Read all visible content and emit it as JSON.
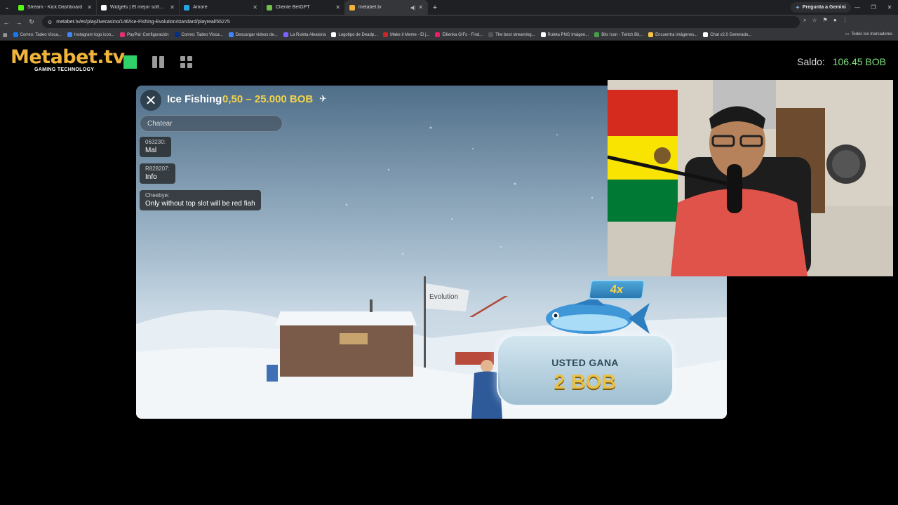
{
  "browser": {
    "tabs": [
      {
        "label": "Stream - Kick Dashboard",
        "color": "#53fc18"
      },
      {
        "label": "Widgets | El mejor software pa",
        "color": "#ffffff"
      },
      {
        "label": "Amore",
        "color": "#29a3e0"
      },
      {
        "label": "Cliente BetGPT",
        "color": "#6fbf4a"
      },
      {
        "label": "metabet.tv",
        "color": "#f0b43c",
        "active": true
      }
    ],
    "gemini_label": "Pregunta a Gemini",
    "url": "metabet.tv/es/play/livecasino/146/Ice-Fishing-Evolution/standard/playreal/55275",
    "bookmarks": [
      "Correo: Tadeo Visca...",
      "Instagram logo icon...",
      "PayPal: Configuración",
      "Correo: Tadeo Visca...",
      "Descargar videos de...",
      "La Ruleta Aleatoria",
      "Logotipo de Deadp...",
      "Make it Meme - El j...",
      "Ellienka GIFs - Find...",
      "The best streaming...",
      "Ruleta PNG Imágen...",
      "Bits Icon - Twitch Bit...",
      "Encuentra imágenes...",
      "Chat v2.0 Generado..."
    ],
    "all_bookmarks_label": "Todos los marcadores"
  },
  "site": {
    "logo": "Metabet.tv",
    "logo_sub": "GAMING TECHNOLOGY",
    "balance_label": "Saldo:",
    "balance_value": "106.45 BOB",
    "accent": "#f0b43c",
    "view_active_color": "#2fd36a"
  },
  "game": {
    "title": "Ice Fishing",
    "limits": "0,50 – 25.000 BOB",
    "chat_placeholder": "Chatear",
    "messages": [
      {
        "user": "063230:",
        "text": "Mal"
      },
      {
        "user": "R828207:",
        "text": "Info"
      },
      {
        "user": "Cheebye:",
        "text": "Only without top slot will be red fiah"
      }
    ],
    "multiplier": "4x",
    "win_title": "USTED GANA",
    "win_amount": "2 BOB",
    "sign_text": "Evolution"
  }
}
